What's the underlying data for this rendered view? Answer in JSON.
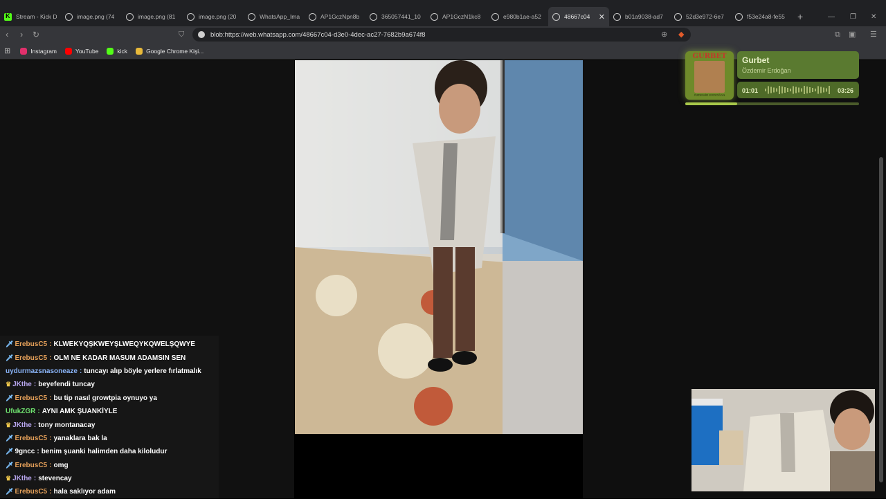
{
  "browser": {
    "tabs": [
      {
        "label": "Stream - Kick D",
        "icon": "kick-icon",
        "active": false
      },
      {
        "label": "image.png (74",
        "icon": "globe-icon",
        "active": false
      },
      {
        "label": "image.png (81",
        "icon": "globe-icon",
        "active": false
      },
      {
        "label": "image.png (20",
        "icon": "globe-icon",
        "active": false
      },
      {
        "label": "WhatsApp_Ima",
        "icon": "globe-icon",
        "active": false
      },
      {
        "label": "AP1GczNpn8b",
        "icon": "globe-icon",
        "active": false
      },
      {
        "label": "365057441_10",
        "icon": "globe-icon",
        "active": false
      },
      {
        "label": "AP1GczN1kc8",
        "icon": "globe-icon",
        "active": false
      },
      {
        "label": "e980b1ae-a52",
        "icon": "globe-icon",
        "active": false
      },
      {
        "label": "48667c04",
        "icon": "globe-icon",
        "active": true
      },
      {
        "label": "b01a9038-ad7",
        "icon": "globe-icon",
        "active": false
      },
      {
        "label": "52d3e972-6e7",
        "icon": "globe-icon",
        "active": false
      },
      {
        "label": "f53e24a8-fe55",
        "icon": "globe-icon",
        "active": false
      }
    ],
    "url": "blob:https://web.whatsapp.com/48667c04-d3e0-4dec-ac27-7682b9a674f8",
    "bookmarks": [
      {
        "label": "Instagram",
        "icon": "instagram-icon",
        "color": "#e1306c"
      },
      {
        "label": "YouTube",
        "icon": "youtube-icon",
        "color": "#ff0000"
      },
      {
        "label": "kick",
        "icon": "kick-icon",
        "color": "#53fc18"
      },
      {
        "label": "Google Chrome Kişi...",
        "icon": "folder-icon",
        "color": "#e8b93a"
      }
    ]
  },
  "music": {
    "title": "Gurbet",
    "artist": "Özdemir Erdoğan",
    "elapsed": "01:01",
    "total": "03:26",
    "progress": 0.3,
    "album_cover_text": "GURBET",
    "album_cover_subtext": "ÖZDEMİR ERDOĞAN",
    "accent": "#5a7a30"
  },
  "chat": {
    "messages": [
      {
        "user": "ErebusC5",
        "badge": "sword-icon",
        "color": "#e8a25a",
        "text": "KLWEKYQŞKWEYŞLWEQYKQWELŞQWYE"
      },
      {
        "user": "ErebusC5",
        "badge": "sword-icon",
        "color": "#e8a25a",
        "text": "OLM NE KADAR MASUM ADAMSIN SEN"
      },
      {
        "user": "uydurmazsnasoneaze",
        "badge": "",
        "color": "#8ab4f8",
        "text": "tuncayı alıp böyle yerlere fırlatmalık"
      },
      {
        "user": "JKthe",
        "badge": "crown-icon",
        "color": "#b9a7f0",
        "text": "beyefendi tuncay"
      },
      {
        "user": "ErebusC5",
        "badge": "sword-icon",
        "color": "#e8a25a",
        "text": "bu tip nasıl growtpia oynuyo ya"
      },
      {
        "user": "UfukZGR",
        "badge": "",
        "color": "#6fe36f",
        "text": "AYNI AMK ŞUANKİYLE"
      },
      {
        "user": "JKthe",
        "badge": "crown-icon",
        "color": "#b9a7f0",
        "text": "tony montanacay"
      },
      {
        "user": "ErebusC5",
        "badge": "sword-icon",
        "color": "#e8a25a",
        "text": "yanaklara bak la"
      },
      {
        "user": "9gncc",
        "badge": "sword-icon",
        "color": "#ffffff",
        "text": "benim şuanki halimden daha kiloludur"
      },
      {
        "user": "ErebusC5",
        "badge": "sword-icon",
        "color": "#e8a25a",
        "text": "omg"
      },
      {
        "user": "JKthe",
        "badge": "crown-icon",
        "color": "#b9a7f0",
        "text": "stevencay"
      },
      {
        "user": "ErebusC5",
        "badge": "sword-icon",
        "color": "#e8a25a",
        "text": "hala saklıyor adam"
      }
    ]
  }
}
